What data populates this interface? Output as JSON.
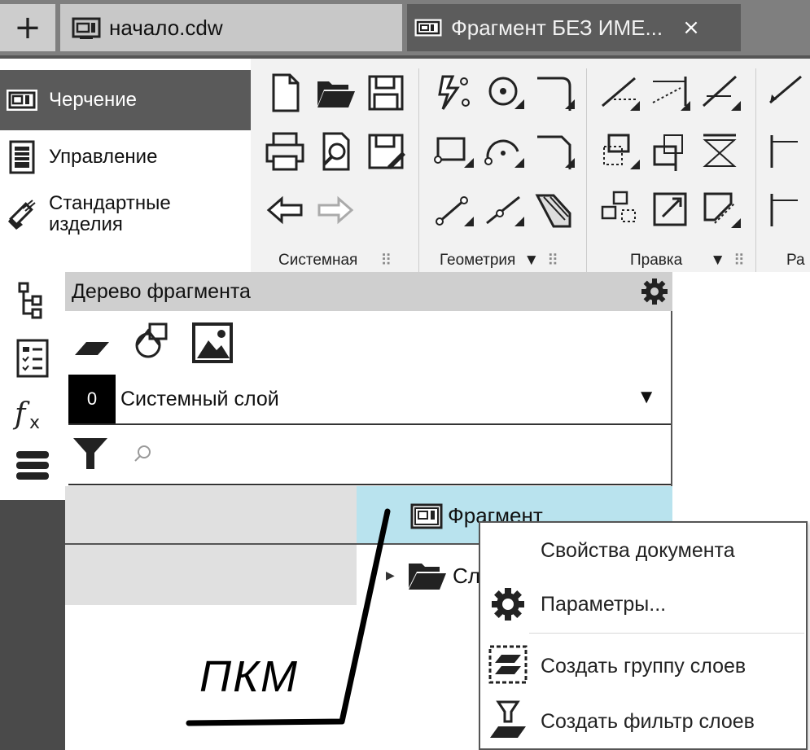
{
  "tabs": {
    "new_tab_label": "+",
    "file_tab": "начало.cdw",
    "active_tab": "Фрагмент БЕЗ ИМЕ...",
    "close_label": "×"
  },
  "ribbon": {
    "categories": [
      "Черчение",
      "Управление",
      "Стандартные изделия"
    ],
    "more_label": "»",
    "groups": [
      "Системная",
      "Геометрия",
      "Правка",
      "Ра"
    ]
  },
  "tree_panel": {
    "title": "Дерево фрагмента",
    "layer_number": "0",
    "layer_name": "Системный слой",
    "search_placeholder": "",
    "items": [
      "Фрагмент",
      "Сл"
    ]
  },
  "context_menu": {
    "items": [
      "Свойства документа",
      "Параметры...",
      "Создать группу слоев",
      "Создать фильтр слоев"
    ]
  },
  "annotation": {
    "text": "ПКМ"
  },
  "colors": {
    "tab_bar": "#7f7f7f",
    "active_category": "#5a5a5a",
    "tree_highlight": "#b9e3ee",
    "panel_header": "#cfcfcf"
  },
  "icons": [
    "fragment-doc-icon",
    "drawing-icon",
    "list-icon",
    "bolt-icon",
    "gear-icon",
    "folder-icon",
    "filter-icon",
    "search-icon"
  ]
}
